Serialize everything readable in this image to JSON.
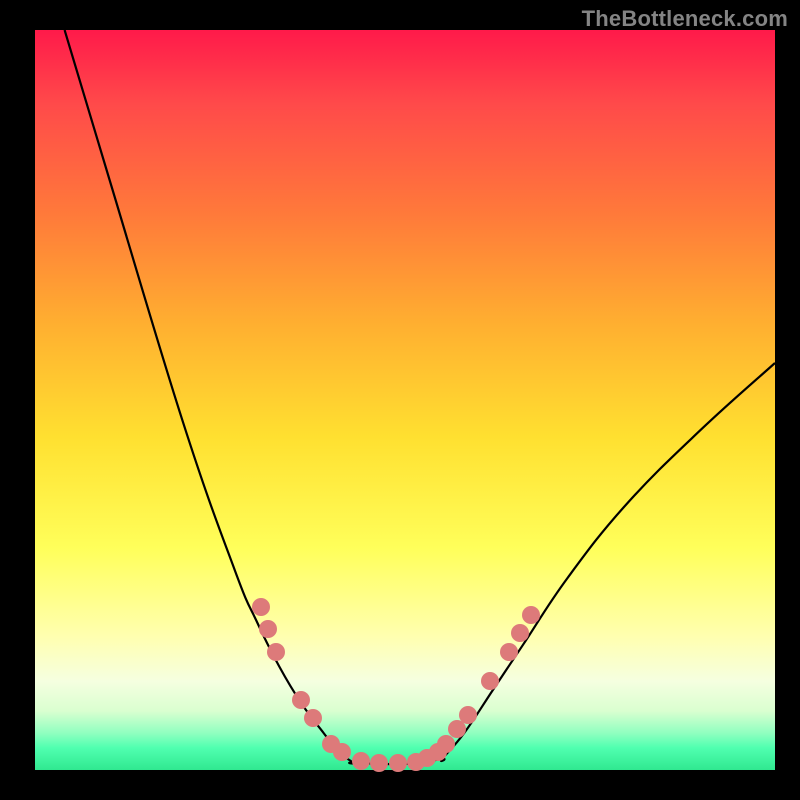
{
  "watermark": "TheBottleneck.com",
  "chart_data": {
    "type": "line",
    "title": "",
    "xlabel": "",
    "ylabel": "",
    "xlim": [
      0,
      100
    ],
    "ylim": [
      0,
      100
    ],
    "series": [
      {
        "name": "left-branch",
        "x": [
          4,
          10,
          20,
          27,
          30,
          33,
          36,
          39,
          41,
          43
        ],
        "y": [
          100,
          80,
          47,
          27,
          20,
          14,
          9,
          5,
          2.5,
          1
        ]
      },
      {
        "name": "flat-valley",
        "x": [
          43,
          50,
          55
        ],
        "y": [
          1,
          0.8,
          1.5
        ]
      },
      {
        "name": "right-branch",
        "x": [
          55,
          58,
          62,
          66,
          72,
          80,
          90,
          100
        ],
        "y": [
          1.5,
          5,
          11,
          17,
          26,
          36,
          46,
          55
        ]
      }
    ],
    "dots": {
      "name": "cluster",
      "points": [
        {
          "x": 30.5,
          "y": 22
        },
        {
          "x": 31.5,
          "y": 19
        },
        {
          "x": 32.5,
          "y": 16
        },
        {
          "x": 36.0,
          "y": 9.5
        },
        {
          "x": 37.5,
          "y": 7
        },
        {
          "x": 40.0,
          "y": 3.5
        },
        {
          "x": 41.5,
          "y": 2.5
        },
        {
          "x": 44.0,
          "y": 1.2
        },
        {
          "x": 46.5,
          "y": 1.0
        },
        {
          "x": 49.0,
          "y": 0.9
        },
        {
          "x": 51.5,
          "y": 1.1
        },
        {
          "x": 53.0,
          "y": 1.6
        },
        {
          "x": 54.5,
          "y": 2.5
        },
        {
          "x": 55.5,
          "y": 3.5
        },
        {
          "x": 57.0,
          "y": 5.5
        },
        {
          "x": 58.5,
          "y": 7.5
        },
        {
          "x": 61.5,
          "y": 12
        },
        {
          "x": 64.0,
          "y": 16
        },
        {
          "x": 65.5,
          "y": 18.5
        },
        {
          "x": 67.0,
          "y": 21
        }
      ]
    },
    "background_gradient": {
      "top": "#ff1a4a",
      "bottom": "#30e890"
    }
  }
}
